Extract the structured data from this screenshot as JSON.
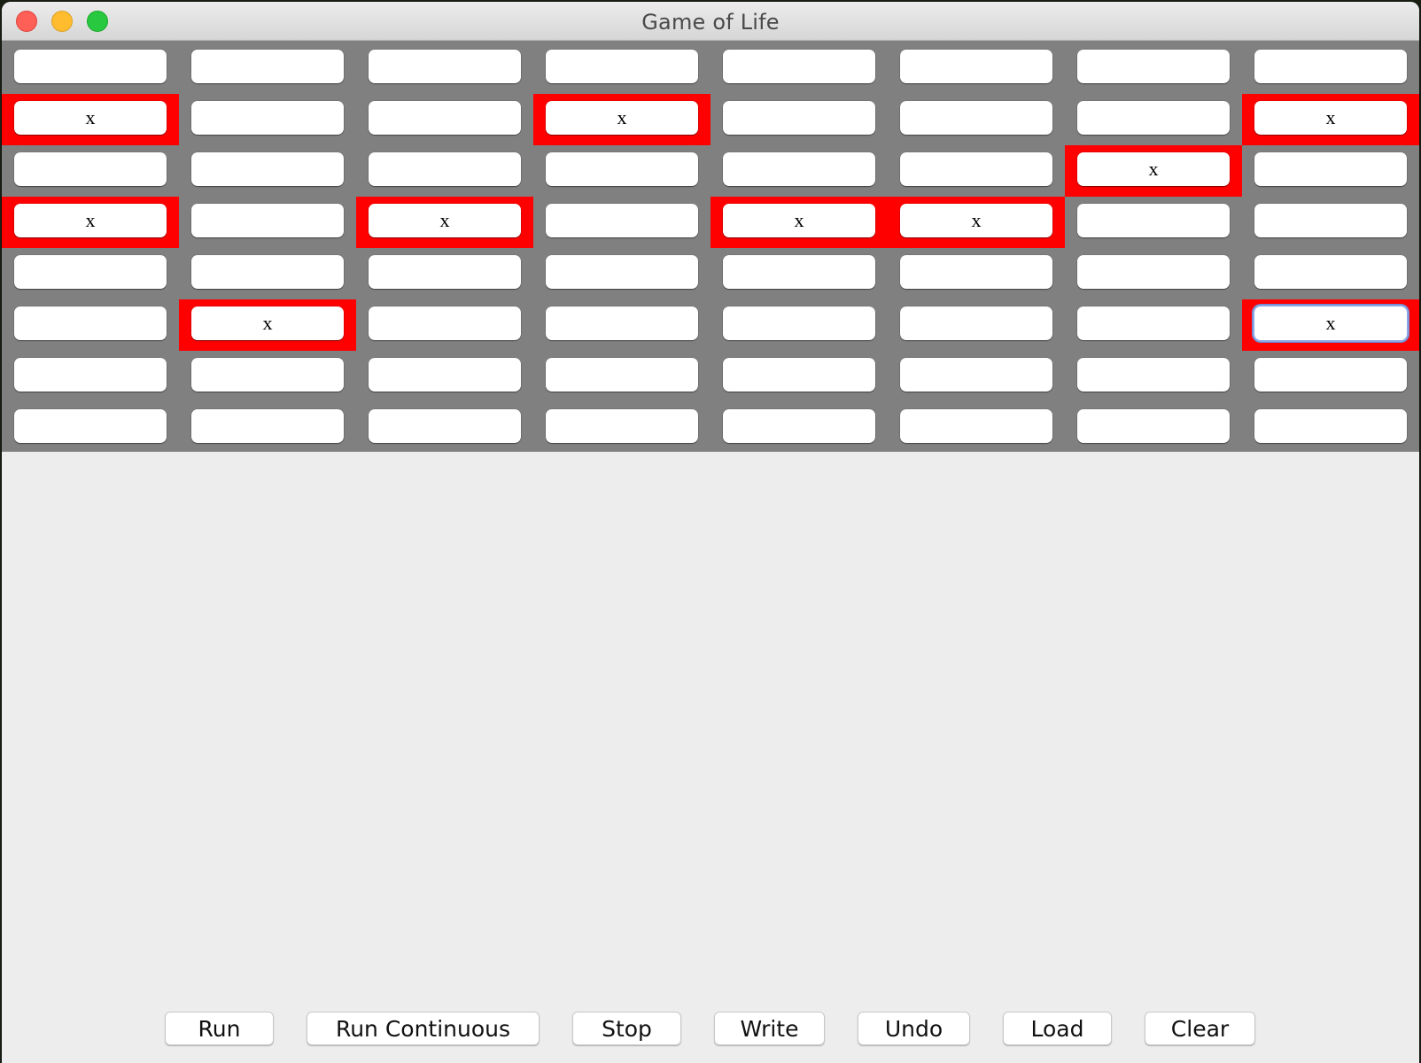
{
  "window": {
    "title": "Game of Life",
    "controls": [
      "close",
      "minimize",
      "zoom"
    ]
  },
  "grid": {
    "rows": 8,
    "cols": 8,
    "live_mark": "x",
    "alive_color": "#ff0000",
    "dead_color": "#808080",
    "cells": [
      [
        "",
        "",
        "",
        "",
        "",
        "",
        "",
        ""
      ],
      [
        "x",
        "",
        "",
        "x",
        "",
        "",
        "",
        "x"
      ],
      [
        "",
        "",
        "",
        "",
        "",
        "",
        "x",
        ""
      ],
      [
        "x",
        "",
        "x",
        "",
        "x",
        "x",
        "",
        ""
      ],
      [
        "",
        "",
        "",
        "",
        "",
        "",
        "",
        ""
      ],
      [
        "",
        "x",
        "",
        "",
        "",
        "",
        "",
        "x"
      ],
      [
        "",
        "",
        "",
        "",
        "",
        "",
        "",
        ""
      ],
      [
        "",
        "",
        "",
        "",
        "",
        "",
        "",
        ""
      ]
    ],
    "focused_cell": {
      "row": 6,
      "col": 8
    }
  },
  "toolbar": {
    "buttons": [
      {
        "id": "run",
        "label": "Run"
      },
      {
        "id": "run-continuous",
        "label": "Run Continuous"
      },
      {
        "id": "stop",
        "label": "Stop"
      },
      {
        "id": "write",
        "label": "Write"
      },
      {
        "id": "undo",
        "label": "Undo"
      },
      {
        "id": "load",
        "label": "Load"
      },
      {
        "id": "clear",
        "label": "Clear"
      }
    ]
  }
}
